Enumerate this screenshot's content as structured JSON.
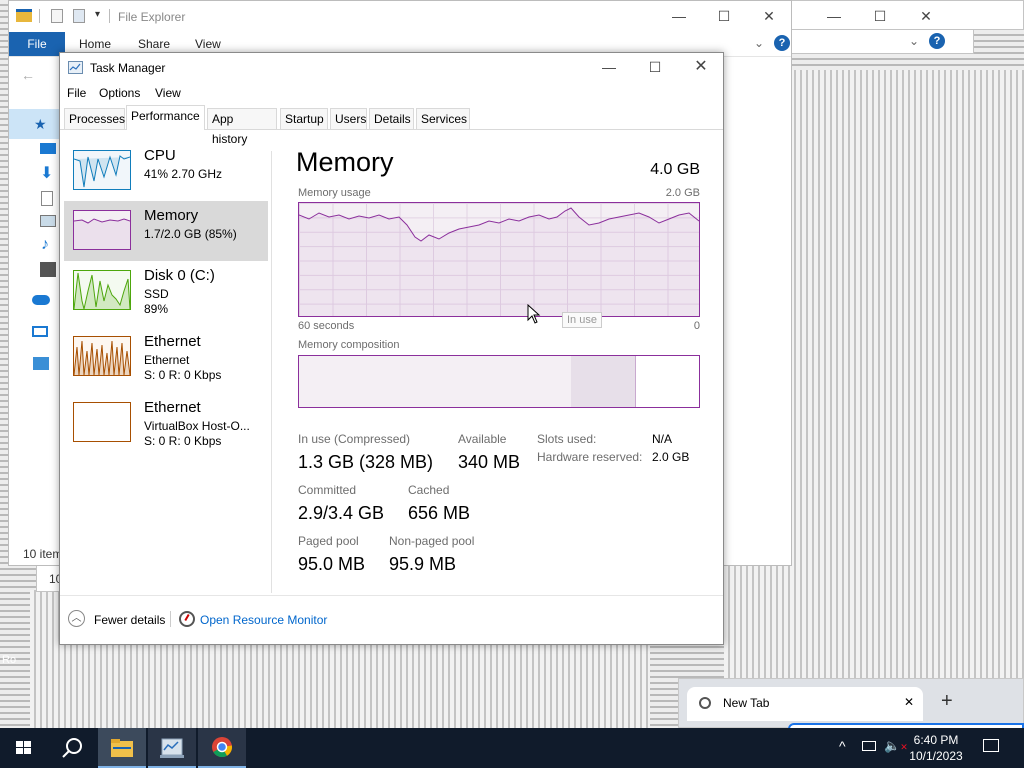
{
  "file_explorer": {
    "title": "File Explorer",
    "ribbon": {
      "file": "File",
      "home": "Home",
      "share": "Share",
      "view": "View"
    },
    "status_items": "10 item",
    "status_items_2": "10"
  },
  "desktop": {
    "recycle_label": "Ro"
  },
  "task_manager": {
    "title": "Task Manager",
    "menu": {
      "file": "File",
      "options": "Options",
      "view": "View"
    },
    "tabs": [
      "Processes",
      "Performance",
      "App history",
      "Startup",
      "Users",
      "Details",
      "Services"
    ],
    "sidebar": [
      {
        "name": "CPU",
        "line1": "41% 2.70 GHz",
        "line2": ""
      },
      {
        "name": "Memory",
        "line1": "1.7/2.0 GB (85%)",
        "line2": ""
      },
      {
        "name": "Disk 0 (C:)",
        "line1": "SSD",
        "line2": "89%"
      },
      {
        "name": "Ethernet",
        "line1": "Ethernet",
        "line2": "S: 0 R: 0 Kbps"
      },
      {
        "name": "Ethernet",
        "line1": "VirtualBox Host-O...",
        "line2": "S: 0 R: 0 Kbps"
      }
    ],
    "memory": {
      "heading": "Memory",
      "total": "4.0 GB",
      "usage_label": "Memory usage",
      "usage_max": "2.0 GB",
      "x_left": "60 seconds",
      "x_right": "0",
      "tooltip": "In use",
      "composition_label": "Memory composition",
      "composition": {
        "in_use_fraction": 0.68,
        "modified_fraction": 0.16
      },
      "stats": {
        "in_use_label": "In use (Compressed)",
        "in_use_value": "1.3 GB (328 MB)",
        "available_label": "Available",
        "available_value": "340 MB",
        "committed_label": "Committed",
        "committed_value": "2.9/3.4 GB",
        "cached_label": "Cached",
        "cached_value": "656 MB",
        "paged_label": "Paged pool",
        "paged_value": "95.0 MB",
        "nonpaged_label": "Non-paged pool",
        "nonpaged_value": "95.9 MB",
        "slots_label": "Slots used:",
        "slots_value": "N/A",
        "hw_label": "Hardware reserved:",
        "hw_value": "2.0 GB"
      }
    },
    "footer": {
      "fewer": "Fewer details",
      "resource_monitor": "Open Resource Monitor"
    }
  },
  "chrome": {
    "tab_title": "New Tab"
  },
  "taskbar": {
    "time": "6:40 PM",
    "date": "10/1/2023"
  },
  "colors": {
    "memory_accent": "#8b2f9c",
    "cpu_accent": "#117dbb",
    "disk_accent": "#4da60c",
    "ethernet_accent": "#a74f01",
    "link": "#0066cc"
  }
}
